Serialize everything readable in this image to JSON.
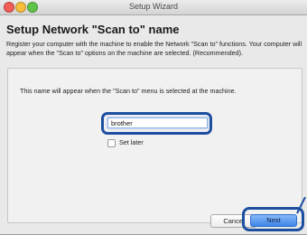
{
  "window": {
    "title": "Setup Wizard"
  },
  "heading": "Setup Network \"Scan to\" name",
  "description": "Register your computer with the machine to enable the Network \"Scan to\" functions. Your computer will appear when the \"Scan to\" options on the machine are selected. (Recommended).",
  "panel": {
    "info": "This name will appear when the \"Scan to\" menu is selected at the machine.",
    "name_field": {
      "value": "brother"
    },
    "set_later": {
      "label": "Set later",
      "checked": false
    }
  },
  "buttons": {
    "cancel": "Cancel",
    "next": "Next"
  },
  "colors": {
    "highlight": "#1d4fa0",
    "primary_button": "#3f86ea"
  },
  "icons": {
    "close": "close-traffic-light",
    "minimize": "minimize-traffic-light",
    "maximize": "zoom-traffic-light",
    "pointer": "callout-arrow"
  }
}
